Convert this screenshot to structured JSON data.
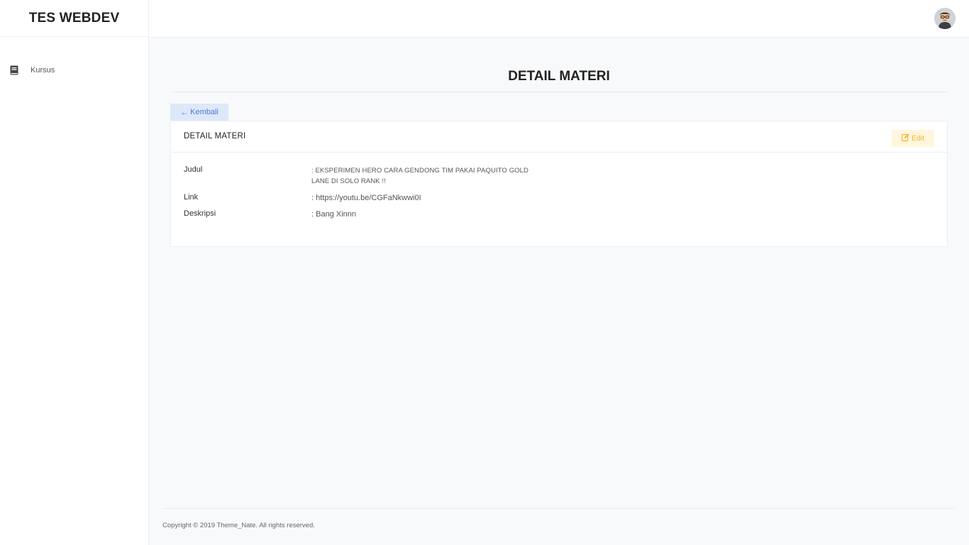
{
  "brand": {
    "title": "TES WEBDEV"
  },
  "sidebar": {
    "items": [
      {
        "label": "Kursus",
        "icon": "book-icon"
      }
    ]
  },
  "header": {
    "avatar_icon": "user-avatar"
  },
  "main": {
    "page_title": "DETAIL MATERI",
    "back_label": "Kembali",
    "card": {
      "title": "DETAIL MATERI",
      "edit_label": "Edit",
      "fields": [
        {
          "label": "Judul",
          "value": ": EKSPERIMEN HERO CARA GENDONG TIM PAKAI PAQUITO GOLD LANE DI SOLO RANK !!"
        },
        {
          "label": "Link",
          "value": ": https://youtu.be/CGFaNkwwi0I"
        },
        {
          "label": "Deskripsi",
          "value": ": Bang Xinnn"
        }
      ]
    }
  },
  "footer": {
    "copyright": "Copyright © 2019 Theme_Nate. All rights reserved."
  },
  "colors": {
    "primary": "#4a78d6",
    "primary_bg": "#dde8fb",
    "warning": "#f2b632",
    "warning_bg": "#fff6dd",
    "background": "#f8f9fb"
  }
}
